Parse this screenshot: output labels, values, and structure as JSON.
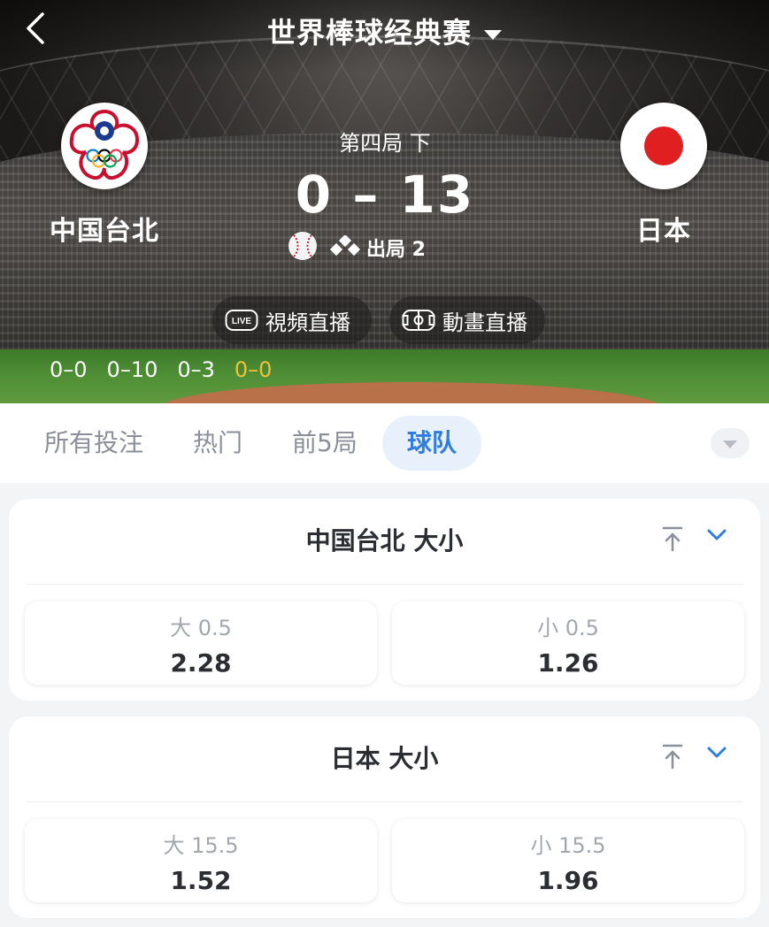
{
  "header": {
    "league_title": "世界棒球经典赛",
    "home_team": "中国台北",
    "away_team": "日本",
    "period": "第四局 下",
    "score": "0 – 13",
    "outs": "出局 2",
    "live_video_label": "視頻直播",
    "animation_label": "動畫直播",
    "innings": [
      "0–0",
      "0–10",
      "0–3",
      "0–0"
    ]
  },
  "tabs": [
    "所有投注",
    "热门",
    "前5局",
    "球队"
  ],
  "active_tab": "球队",
  "markets": [
    {
      "title": "中国台北 大小",
      "options": [
        {
          "label": "大 0.5",
          "odds": "2.28"
        },
        {
          "label": "小 0.5",
          "odds": "1.26"
        }
      ]
    },
    {
      "title": "日本 大小",
      "options": [
        {
          "label": "大 15.5",
          "odds": "1.52"
        },
        {
          "label": "小 15.5",
          "odds": "1.96"
        }
      ]
    }
  ],
  "colors": {
    "accent": "#2f7de1",
    "current_inning": "#f0c23a",
    "japan_red": "#e02020"
  }
}
